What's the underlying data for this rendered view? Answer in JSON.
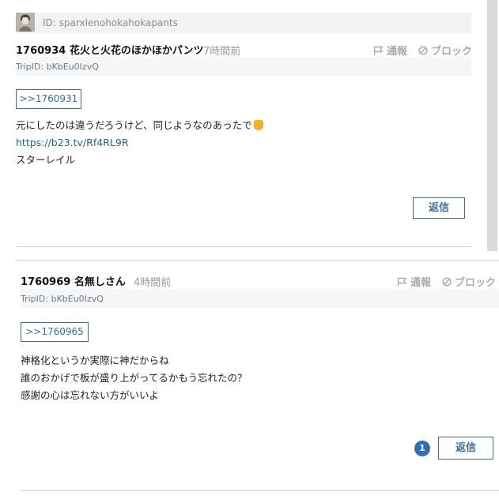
{
  "post1": {
    "user_id": "ID: sparxlenohokahokapants",
    "number": "1760934",
    "name": "花火と火花のほかほかパンツ",
    "time": "7時間前",
    "report_label": "通報",
    "block_label": "ブロック",
    "trip": "TripID: bKbEu0IzvQ",
    "anchor": ">>1760931",
    "lines": [
      "元にしたのは違うだろうけど、同じようなのあったで"
    ],
    "link": "https://b23.tv/Rf4RL9R",
    "after_link": "スターレイル",
    "reply_label": "返信"
  },
  "post2": {
    "number": "1760969",
    "name": "名無しさん",
    "time": "4時間前",
    "report_label": "通報",
    "block_label": "ブロック",
    "trip": "TripID: bKbEu0IzvQ",
    "anchor": ">>1760965",
    "lines": [
      "神格化というか実際に神だからね",
      "誰のおかげで板が盛り上がってるかもう忘れたの？",
      "感謝の心は忘れない方がいいよ"
    ],
    "reply_count": "1",
    "reply_label": "返信"
  }
}
